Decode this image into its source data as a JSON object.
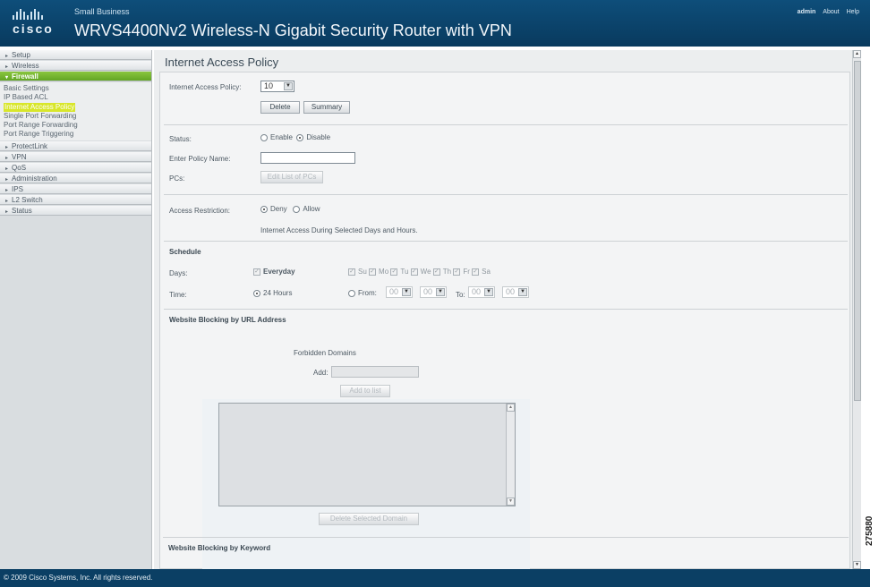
{
  "header": {
    "brand": "cisco",
    "tagline": "Small Business",
    "model": "WRVS4400Nv2 Wireless-N Gigabit Security Router with VPN",
    "links": [
      "admin",
      "About",
      "Help"
    ]
  },
  "sidebar": {
    "items": [
      "Setup",
      "Wireless",
      "Firewall",
      "ProtectLink",
      "VPN",
      "QoS",
      "Administration",
      "IPS",
      "L2 Switch",
      "Status"
    ],
    "firewall_sub": [
      "Basic Settings",
      "IP Based ACL",
      "Internet Access Policy",
      "Single Port Forwarding",
      "Port Range Forwarding",
      "Port Range Triggering"
    ]
  },
  "main": {
    "title": "Internet Access Policy",
    "policy_label": "Internet Access Policy:",
    "policy_value": "10",
    "delete_label": "Delete",
    "summary_label": "Summary",
    "status_label": "Status:",
    "enable_label": "Enable",
    "disable_label": "Disable",
    "policy_name_label": "Enter Policy Name:",
    "policy_name_value": "",
    "pcs_label": "PCs:",
    "edit_pcs_label": "Edit List of PCs",
    "access_restriction_label": "Access Restriction:",
    "deny_label": "Deny",
    "allow_label": "Allow",
    "access_note": "Internet Access During Selected Days and Hours.",
    "schedule_heading": "Schedule",
    "days_label": "Days:",
    "everyday_label": "Everyday",
    "days": [
      "Su",
      "Mo",
      "Tu",
      "We",
      "Th",
      "Fr",
      "Sa"
    ],
    "time_label": "Time:",
    "hours24_label": "24 Hours",
    "from_label": "From:",
    "to_label": "To:",
    "time_values": [
      "00",
      "00",
      "00",
      "00"
    ],
    "url_blocking_heading": "Website Blocking by URL Address",
    "forbidden_domains_label": "Forbidden Domains",
    "add_label": "Add:",
    "add_value": "",
    "add_to_list_label": "Add to list",
    "delete_selected_label": "Delete Selected Domain",
    "keyword_blocking_heading": "Website Blocking by Keyword"
  },
  "footer": {
    "copyright": "© 2009 Cisco Systems, Inc. All rights reserved."
  },
  "figure_ref": "275880"
}
